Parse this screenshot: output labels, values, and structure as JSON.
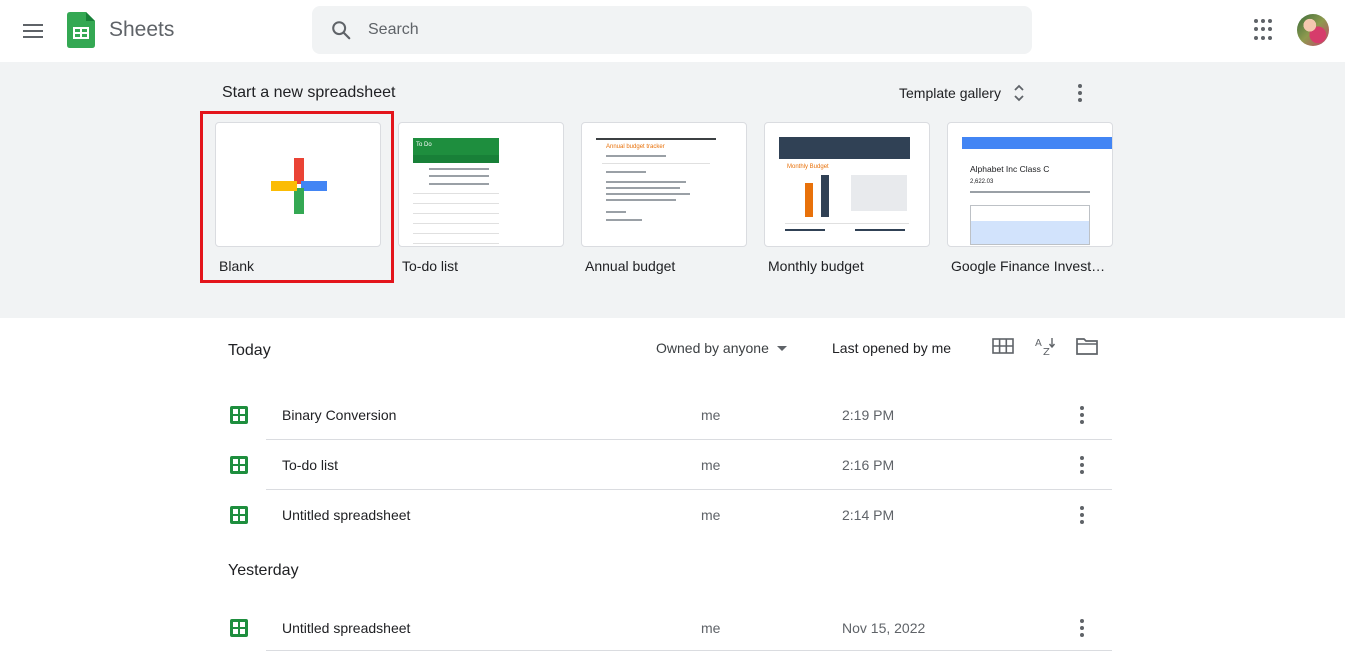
{
  "header": {
    "app_title": "Sheets",
    "search_placeholder": "Search",
    "brand_color": "#34a853"
  },
  "templates": {
    "heading": "Start a new spreadsheet",
    "gallery_label": "Template gallery",
    "items": [
      {
        "label": "Blank",
        "selected": true
      },
      {
        "label": "To-do list",
        "thumb_title": "To Do"
      },
      {
        "label": "Annual budget",
        "thumb_title": "Annual budget tracker"
      },
      {
        "label": "Monthly budget",
        "thumb_title": "Monthly Budget"
      },
      {
        "label": "Google Finance Investment Tracker",
        "thumb_title": "Alphabet Inc Class C",
        "thumb_value": "2,622.03"
      }
    ],
    "highlight_color": "#e3141b"
  },
  "files": {
    "filter_owner": "Owned by anyone",
    "sort_label": "Last opened by me",
    "sections": [
      {
        "title": "Today",
        "rows": [
          {
            "name": "Binary Conversion",
            "owner": "me",
            "date": "2:19 PM"
          },
          {
            "name": "To-do list",
            "owner": "me",
            "date": "2:16 PM"
          },
          {
            "name": "Untitled spreadsheet",
            "owner": "me",
            "date": "2:14 PM"
          }
        ]
      },
      {
        "title": "Yesterday",
        "rows": [
          {
            "name": "Untitled spreadsheet",
            "owner": "me",
            "date": "Nov 15, 2022"
          }
        ]
      }
    ]
  }
}
